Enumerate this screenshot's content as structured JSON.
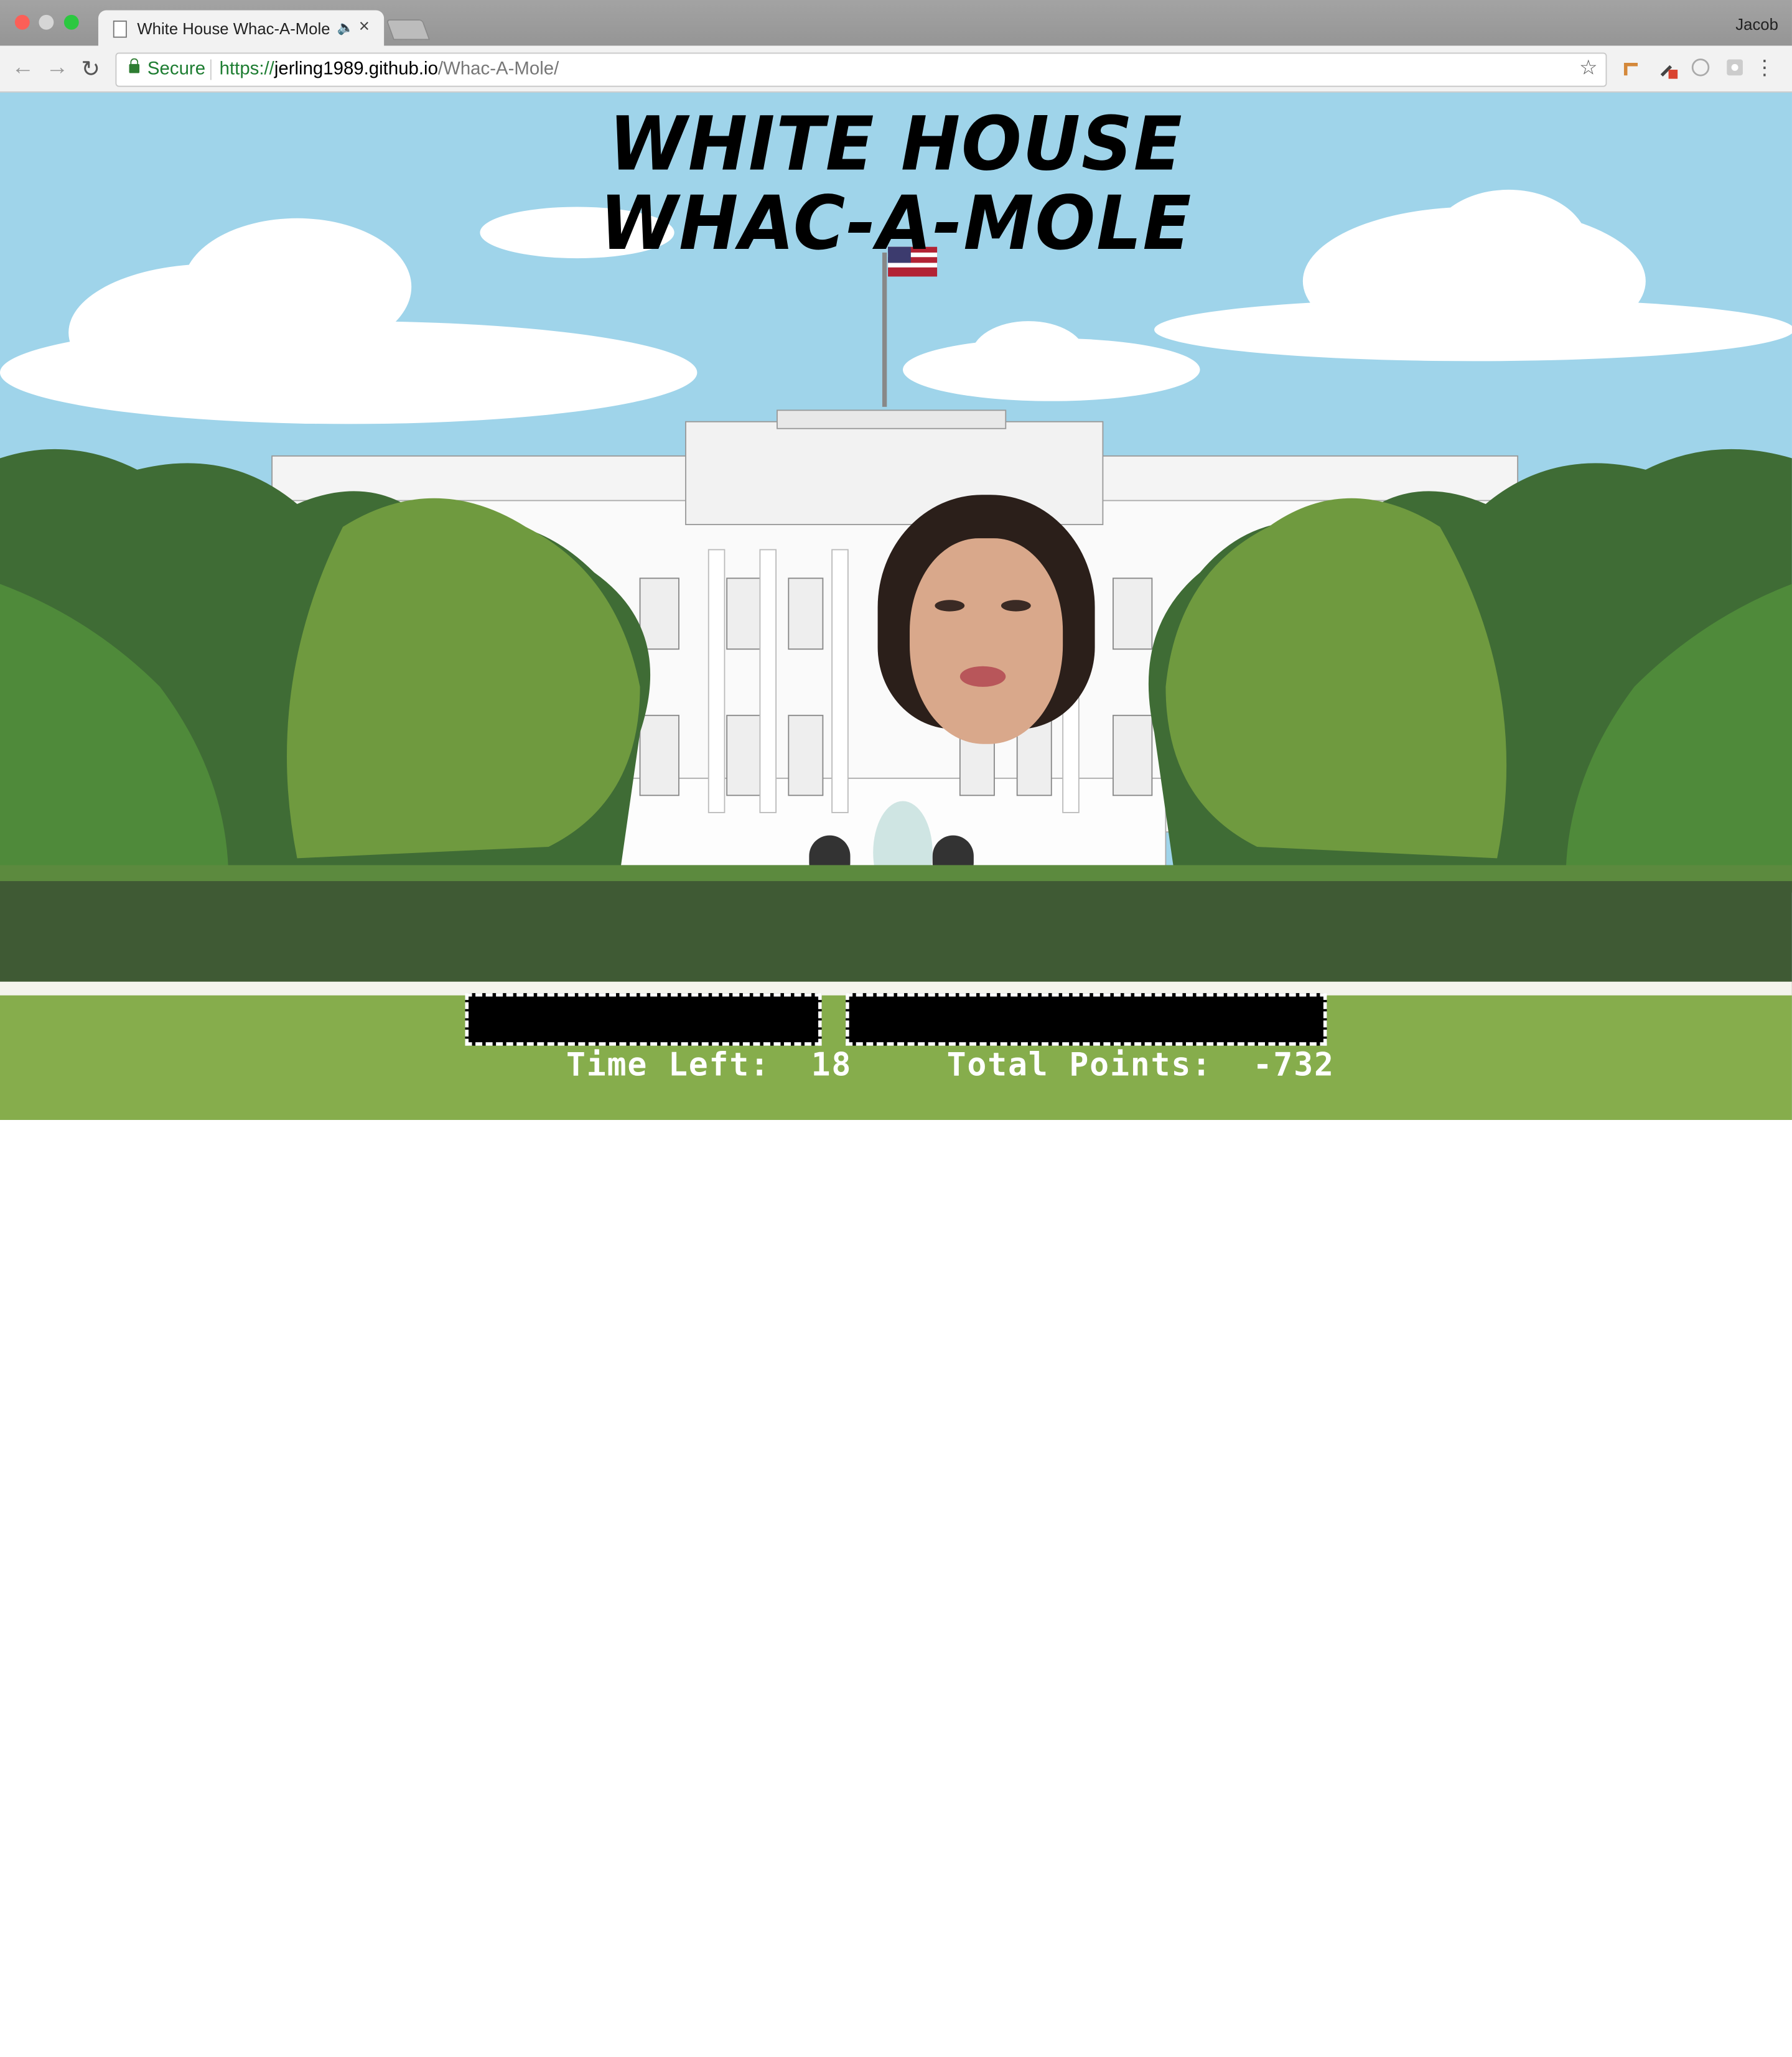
{
  "browser": {
    "tab_title": "White House Whac-A-Mole",
    "profile_name": "Jacob",
    "security_label": "Secure",
    "url_scheme": "https://",
    "url_host": "jerling1989.github.io",
    "url_path": "/Whac-A-Mole/"
  },
  "game": {
    "title_line1": "WHITE HOUSE",
    "title_line2": "WHAC-A-MOLE",
    "time_left_label": "Time Left:",
    "time_left_value": "18",
    "points_label": "Total Points:",
    "points_value": "-732"
  },
  "colors": {
    "sky": "#9fd4ea",
    "hedge": "#3f5a34",
    "lawn": "#86ad4c",
    "secure_green": "#1e7d32"
  }
}
